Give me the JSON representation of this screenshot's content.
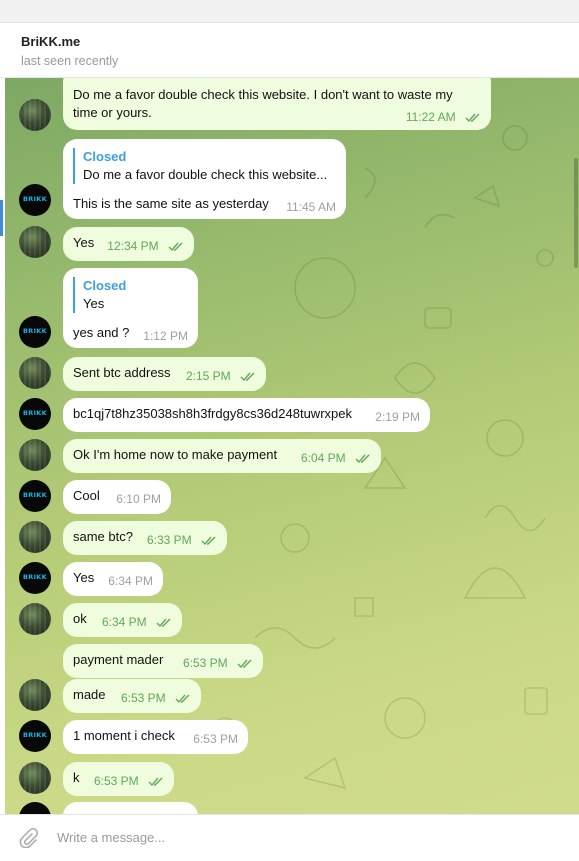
{
  "header": {
    "title": "BriKK.me",
    "status": "last seen recently"
  },
  "composer": {
    "placeholder": "Write a message..."
  },
  "messages": [
    {
      "text": "Do me a favor double check this website. I don't want to waste my time or yours.",
      "line1": "Do me a favor double check this website. I don't want to waste my",
      "line2": "time or yours.",
      "time": "11:22 AM",
      "direction": "out"
    },
    {
      "reply_name": "Closed",
      "reply_text": "Do me a favor double check this website...",
      "text": "This is the same site as yesterday",
      "time": "11:45 AM",
      "direction": "in"
    },
    {
      "text": "Yes",
      "time": "12:34 PM",
      "direction": "out"
    },
    {
      "reply_name": "Closed",
      "reply_text": "Yes",
      "text": "yes and ?",
      "time": "1:12 PM",
      "direction": "in"
    },
    {
      "text": "Sent btc address",
      "time": "2:15 PM",
      "direction": "out"
    },
    {
      "text": "bc1qj7t8hz35038sh8h3frdgy8cs36d248tuwrxpek",
      "time": "2:19 PM",
      "direction": "in"
    },
    {
      "text": "Ok I'm home now to make payment",
      "time": "6:04 PM",
      "direction": "out"
    },
    {
      "text": "Cool",
      "time": "6:10 PM",
      "direction": "in"
    },
    {
      "text": "same btc?",
      "time": "6:33 PM",
      "direction": "out"
    },
    {
      "text": "Yes",
      "time": "6:34 PM",
      "direction": "in"
    },
    {
      "text": "ok",
      "time": "6:34 PM",
      "direction": "out"
    },
    {
      "text": "payment mader",
      "time": "6:53 PM",
      "direction": "out"
    },
    {
      "text": "made",
      "time": "6:53 PM",
      "direction": "out"
    },
    {
      "text": "1 moment i check",
      "time": "6:53 PM",
      "direction": "in"
    },
    {
      "text": "k",
      "time": "6:53 PM",
      "direction": "out"
    }
  ],
  "avatars": {
    "brikk_label": "BRIKK"
  },
  "colors": {
    "outgoing_bubble": "#effdde",
    "incoming_bubble": "#ffffff",
    "accent": "#3d9fe0",
    "check": "#5fa85a"
  },
  "icons": {
    "attach": "paperclip-icon",
    "read": "double-check-icon"
  }
}
